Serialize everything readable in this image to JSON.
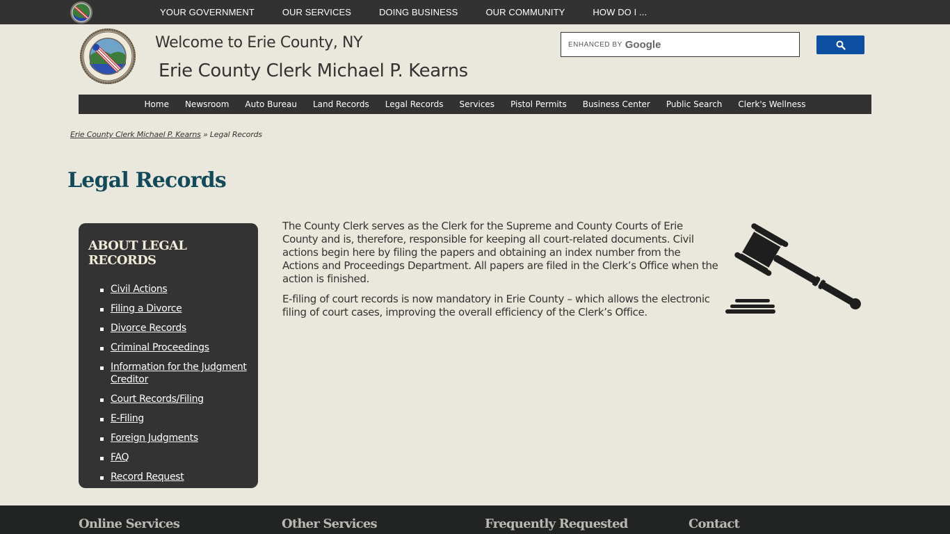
{
  "top_nav": {
    "items": [
      {
        "label": "YOUR GOVERNMENT"
      },
      {
        "label": "OUR SERVICES"
      },
      {
        "label": "DOING BUSINESS"
      },
      {
        "label": "OUR COMMUNITY"
      },
      {
        "label": "HOW DO I ..."
      }
    ]
  },
  "header": {
    "welcome": "Welcome to Erie County, NY",
    "title": "Erie County Clerk Michael P. Kearns"
  },
  "search": {
    "enhanced_by": "ENHANCED BY",
    "brand": "Google",
    "placeholder": "enhanced by Google",
    "button_icon": "search-icon"
  },
  "main_nav": {
    "items": [
      {
        "label": "Home"
      },
      {
        "label": "Newsroom"
      },
      {
        "label": "Auto Bureau"
      },
      {
        "label": "Land Records"
      },
      {
        "label": "Legal Records"
      },
      {
        "label": "Services"
      },
      {
        "label": "Pistol Permits"
      },
      {
        "label": "Business Center"
      },
      {
        "label": "Public Search"
      },
      {
        "label": "Clerk's Wellness"
      }
    ]
  },
  "breadcrumb": {
    "parent": "Erie County Clerk Michael P. Kearns",
    "separator": "»",
    "current": "Legal Records"
  },
  "page": {
    "title": "Legal Records"
  },
  "sidebar": {
    "heading": "ABOUT LEGAL RECORDS",
    "links": [
      {
        "label": "Civil Actions"
      },
      {
        "label": "Filing a Divorce"
      },
      {
        "label": "Divorce Records"
      },
      {
        "label": "Criminal Proceedings"
      },
      {
        "label": "Information for the Judgment Creditor"
      },
      {
        "label": "Court Records/Filing"
      },
      {
        "label": "E-Filing"
      },
      {
        "label": "Foreign Judgments"
      },
      {
        "label": "FAQ"
      },
      {
        "label": "Record Request"
      }
    ]
  },
  "content": {
    "paragraphs": [
      "The County Clerk serves as the Clerk for the Supreme and County Courts of Erie County and is, therefore, responsible for keeping all court-related documents.  Civil actions begin here by filing the papers and obtaining an index number from the Actions and Proceedings Department.  All papers are filed in the Clerk’s Office when the action is finished.",
      "E-filing of court records is now mandatory in Erie County – which allows the electronic filing of court cases, improving the overall efficiency of the Clerk’s Office."
    ],
    "image_icon": "gavel-icon"
  },
  "footer": {
    "headings": [
      {
        "label": "Online Services"
      },
      {
        "label": "Other Services"
      },
      {
        "label": "Frequently Requested"
      },
      {
        "label": "Contact"
      }
    ]
  },
  "colors": {
    "background": "#eae7dd",
    "nav_dark": "#323232",
    "title_teal": "#134a5a",
    "search_blue": "#0b4ea2",
    "footer": "#222423"
  }
}
